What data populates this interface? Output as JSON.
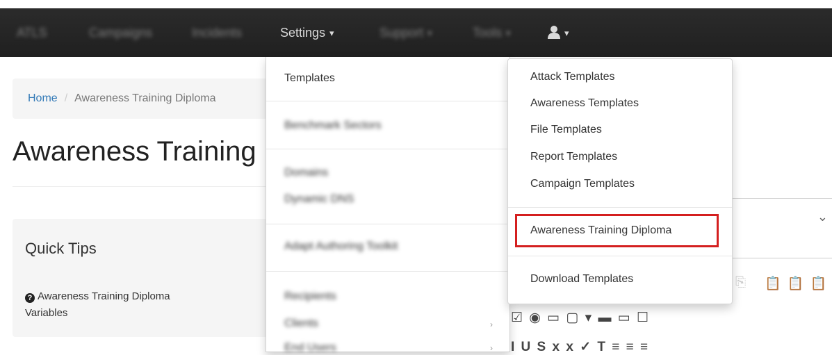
{
  "navbar": {
    "brand": "ATLS",
    "items": [
      {
        "label": "Campaigns"
      },
      {
        "label": "Incidents"
      },
      {
        "label": "Settings"
      },
      {
        "label": "Support"
      },
      {
        "label": "Tools"
      }
    ],
    "user_icon": "user-icon"
  },
  "breadcrumb": {
    "home": "Home",
    "separator": "/",
    "current": "Awareness Training Diploma"
  },
  "page": {
    "title": "Awareness Training Diploma"
  },
  "quick_tips": {
    "title": "Quick Tips",
    "line1": "Awareness Training Diploma",
    "line2": "Variables",
    "icon": "question-circle-icon"
  },
  "settings_menu": {
    "items": [
      {
        "label": "Templates"
      },
      {
        "label": "Benchmark Sectors"
      },
      {
        "label": "Domains"
      },
      {
        "label": "Dynamic DNS"
      },
      {
        "label": "Adapt Authoring Toolkit"
      },
      {
        "label": "Recipients"
      },
      {
        "label": "Clients"
      },
      {
        "label": "End Users"
      }
    ]
  },
  "templates_submenu": {
    "items": [
      {
        "label": "Attack Templates"
      },
      {
        "label": "Awareness Templates"
      },
      {
        "label": "File Templates"
      },
      {
        "label": "Report Templates"
      },
      {
        "label": "Campaign Templates"
      },
      {
        "label": "Awareness Training Diploma"
      },
      {
        "label": "Download Templates"
      }
    ]
  },
  "colors": {
    "navbar": "#222222",
    "link": "#337ab7",
    "highlight": "#d41f1f"
  }
}
